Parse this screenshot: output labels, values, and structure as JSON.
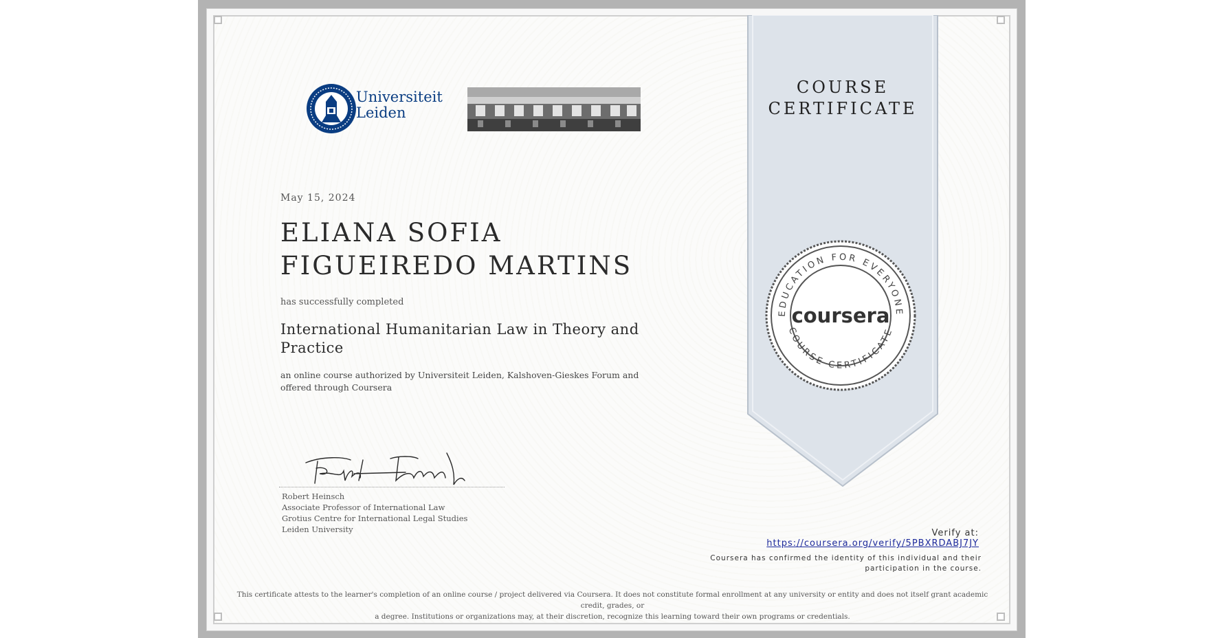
{
  "certificate": {
    "heading": "COURSE CERTIFICATE",
    "date": "May 15, 2024",
    "recipient_name": "ELIANA SOFIA FIGUEIREDO MARTINS",
    "completed_text": "has successfully completed",
    "course_title": "International Humanitarian Law in Theory and Practice",
    "authorized_text": "an online course authorized by Universiteit Leiden, Kalshoven-Gieskes Forum and offered through Coursera"
  },
  "logos": {
    "university_line1": "Universiteit",
    "university_line2": "Leiden",
    "university_color": "#0a3d82"
  },
  "signatory": {
    "name": "Robert Heinsch",
    "title": "Associate Professor of International Law",
    "department": "Grotius Centre for International Legal Studies",
    "institution": "Leiden University"
  },
  "seal": {
    "brand": "coursera",
    "ring_text_top": "EDUCATION FOR EVERYONE",
    "ring_text_bottom": "COURSE CERTIFICATE"
  },
  "verification": {
    "label": "Verify at:",
    "url": "https://coursera.org/verify/5PBXRDABJ7JY",
    "confirmed_line1": "Coursera has confirmed the identity of this individual and their",
    "confirmed_line2": "participation in the course."
  },
  "disclaimer": {
    "line1": "This certificate attests to the learner's completion of an online course / project delivered via Coursera. It does not constitute formal enrollment at any university or entity and does not itself grant academic credit, grades, or",
    "line2": "a degree. Institutions or organizations may, at their discretion, recognize this learning toward their own programs or credentials."
  },
  "colors": {
    "ribbon": "#dde3ea",
    "frame": "#b3b3b3",
    "link": "#1d2a9c"
  }
}
